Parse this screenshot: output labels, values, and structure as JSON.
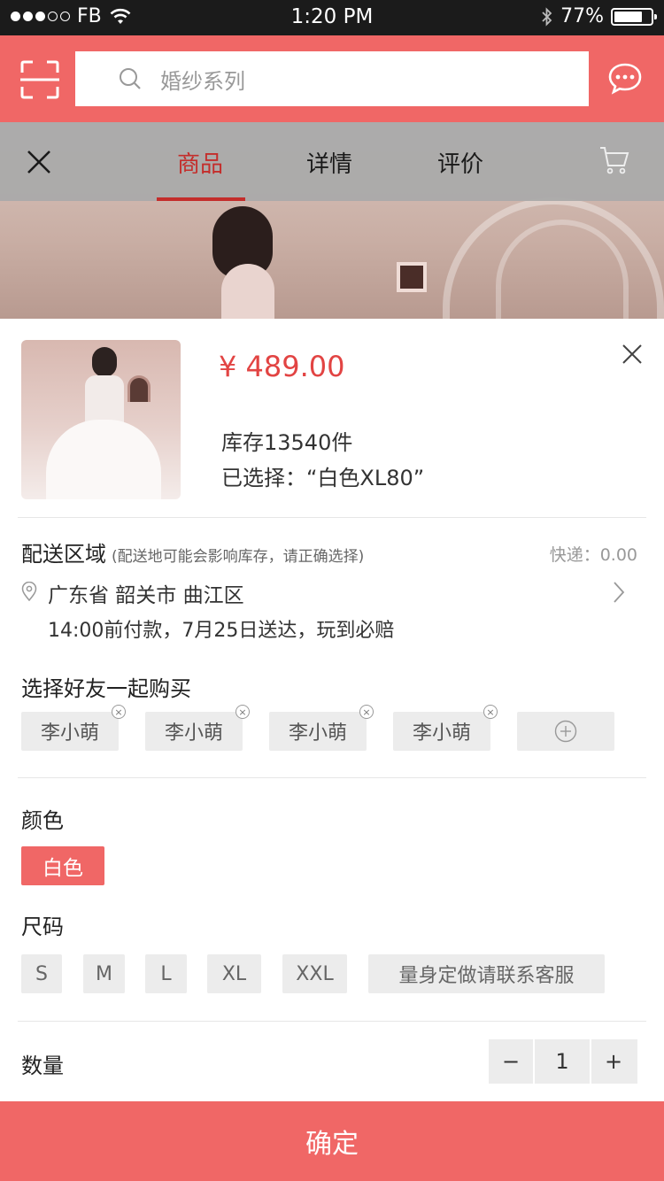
{
  "status_bar": {
    "carrier": "FB",
    "time": "1:20 PM",
    "battery": "77%",
    "battery_level": 0.77
  },
  "header": {
    "search_placeholder": "婚纱系列",
    "scan_icon": "scan-icon",
    "message_icon": "chat-bubble-icon"
  },
  "tabs": {
    "items": [
      {
        "label": "商品",
        "active": true
      },
      {
        "label": "详情",
        "active": false
      },
      {
        "label": "评价",
        "active": false
      }
    ],
    "cart_icon": "cart-icon"
  },
  "product": {
    "price": "¥ 489.00",
    "stock": "库存13540件",
    "selected": "已选择：“白色XL80”"
  },
  "delivery": {
    "title": "配送区域",
    "note": "(配送地可能会影响库存，请正确选择)",
    "shipping_fee": "快递：0.00",
    "address": "广东省 韶关市 曲江区",
    "time": "14:00前付款，7月25日送达，玩到必赔"
  },
  "friends": {
    "title": "选择好友一起购买",
    "names": [
      "李小萌",
      "李小萌",
      "李小萌",
      "李小萌"
    ]
  },
  "color": {
    "title": "颜色",
    "options": [
      "白色"
    ],
    "selected": "白色"
  },
  "size": {
    "title": "尺码",
    "options": [
      "S",
      "M",
      "L",
      "XL",
      "XXL",
      "量身定做请联系客服"
    ]
  },
  "quantity": {
    "title": "数量",
    "value": "1",
    "minus": "−",
    "plus": "+"
  },
  "confirm_label": "确定",
  "colors": {
    "brand": "#f06766",
    "price": "#e24443",
    "tab_active": "#c42d2b"
  }
}
